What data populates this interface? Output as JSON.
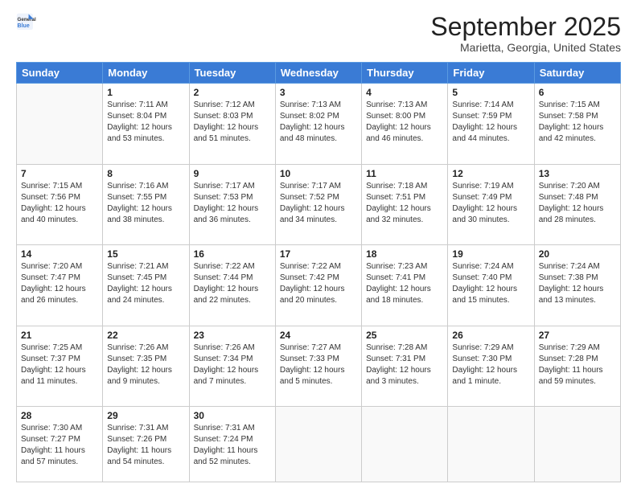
{
  "logo": {
    "line1": "General",
    "line2": "Blue"
  },
  "title": "September 2025",
  "location": "Marietta, Georgia, United States",
  "weekdays": [
    "Sunday",
    "Monday",
    "Tuesday",
    "Wednesday",
    "Thursday",
    "Friday",
    "Saturday"
  ],
  "weeks": [
    [
      {
        "day": "",
        "content": ""
      },
      {
        "day": "1",
        "content": "Sunrise: 7:11 AM\nSunset: 8:04 PM\nDaylight: 12 hours\nand 53 minutes."
      },
      {
        "day": "2",
        "content": "Sunrise: 7:12 AM\nSunset: 8:03 PM\nDaylight: 12 hours\nand 51 minutes."
      },
      {
        "day": "3",
        "content": "Sunrise: 7:13 AM\nSunset: 8:02 PM\nDaylight: 12 hours\nand 48 minutes."
      },
      {
        "day": "4",
        "content": "Sunrise: 7:13 AM\nSunset: 8:00 PM\nDaylight: 12 hours\nand 46 minutes."
      },
      {
        "day": "5",
        "content": "Sunrise: 7:14 AM\nSunset: 7:59 PM\nDaylight: 12 hours\nand 44 minutes."
      },
      {
        "day": "6",
        "content": "Sunrise: 7:15 AM\nSunset: 7:58 PM\nDaylight: 12 hours\nand 42 minutes."
      }
    ],
    [
      {
        "day": "7",
        "content": "Sunrise: 7:15 AM\nSunset: 7:56 PM\nDaylight: 12 hours\nand 40 minutes."
      },
      {
        "day": "8",
        "content": "Sunrise: 7:16 AM\nSunset: 7:55 PM\nDaylight: 12 hours\nand 38 minutes."
      },
      {
        "day": "9",
        "content": "Sunrise: 7:17 AM\nSunset: 7:53 PM\nDaylight: 12 hours\nand 36 minutes."
      },
      {
        "day": "10",
        "content": "Sunrise: 7:17 AM\nSunset: 7:52 PM\nDaylight: 12 hours\nand 34 minutes."
      },
      {
        "day": "11",
        "content": "Sunrise: 7:18 AM\nSunset: 7:51 PM\nDaylight: 12 hours\nand 32 minutes."
      },
      {
        "day": "12",
        "content": "Sunrise: 7:19 AM\nSunset: 7:49 PM\nDaylight: 12 hours\nand 30 minutes."
      },
      {
        "day": "13",
        "content": "Sunrise: 7:20 AM\nSunset: 7:48 PM\nDaylight: 12 hours\nand 28 minutes."
      }
    ],
    [
      {
        "day": "14",
        "content": "Sunrise: 7:20 AM\nSunset: 7:47 PM\nDaylight: 12 hours\nand 26 minutes."
      },
      {
        "day": "15",
        "content": "Sunrise: 7:21 AM\nSunset: 7:45 PM\nDaylight: 12 hours\nand 24 minutes."
      },
      {
        "day": "16",
        "content": "Sunrise: 7:22 AM\nSunset: 7:44 PM\nDaylight: 12 hours\nand 22 minutes."
      },
      {
        "day": "17",
        "content": "Sunrise: 7:22 AM\nSunset: 7:42 PM\nDaylight: 12 hours\nand 20 minutes."
      },
      {
        "day": "18",
        "content": "Sunrise: 7:23 AM\nSunset: 7:41 PM\nDaylight: 12 hours\nand 18 minutes."
      },
      {
        "day": "19",
        "content": "Sunrise: 7:24 AM\nSunset: 7:40 PM\nDaylight: 12 hours\nand 15 minutes."
      },
      {
        "day": "20",
        "content": "Sunrise: 7:24 AM\nSunset: 7:38 PM\nDaylight: 12 hours\nand 13 minutes."
      }
    ],
    [
      {
        "day": "21",
        "content": "Sunrise: 7:25 AM\nSunset: 7:37 PM\nDaylight: 12 hours\nand 11 minutes."
      },
      {
        "day": "22",
        "content": "Sunrise: 7:26 AM\nSunset: 7:35 PM\nDaylight: 12 hours\nand 9 minutes."
      },
      {
        "day": "23",
        "content": "Sunrise: 7:26 AM\nSunset: 7:34 PM\nDaylight: 12 hours\nand 7 minutes."
      },
      {
        "day": "24",
        "content": "Sunrise: 7:27 AM\nSunset: 7:33 PM\nDaylight: 12 hours\nand 5 minutes."
      },
      {
        "day": "25",
        "content": "Sunrise: 7:28 AM\nSunset: 7:31 PM\nDaylight: 12 hours\nand 3 minutes."
      },
      {
        "day": "26",
        "content": "Sunrise: 7:29 AM\nSunset: 7:30 PM\nDaylight: 12 hours\nand 1 minute."
      },
      {
        "day": "27",
        "content": "Sunrise: 7:29 AM\nSunset: 7:28 PM\nDaylight: 11 hours\nand 59 minutes."
      }
    ],
    [
      {
        "day": "28",
        "content": "Sunrise: 7:30 AM\nSunset: 7:27 PM\nDaylight: 11 hours\nand 57 minutes."
      },
      {
        "day": "29",
        "content": "Sunrise: 7:31 AM\nSunset: 7:26 PM\nDaylight: 11 hours\nand 54 minutes."
      },
      {
        "day": "30",
        "content": "Sunrise: 7:31 AM\nSunset: 7:24 PM\nDaylight: 11 hours\nand 52 minutes."
      },
      {
        "day": "",
        "content": ""
      },
      {
        "day": "",
        "content": ""
      },
      {
        "day": "",
        "content": ""
      },
      {
        "day": "",
        "content": ""
      }
    ]
  ]
}
